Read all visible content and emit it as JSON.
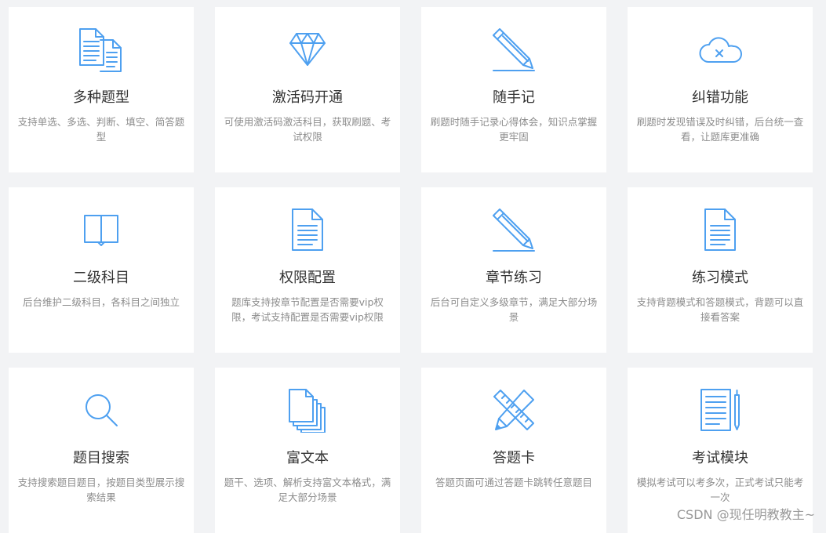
{
  "colors": {
    "accent": "#4ea0f0",
    "title": "#333333",
    "desc": "#8c8c8c",
    "background": "#f2f3f5"
  },
  "features": [
    {
      "icon": "documents-icon",
      "title": "多种题型",
      "desc": "支持单选、多选、判断、填空、简答题型"
    },
    {
      "icon": "diamond-icon",
      "title": "激活码开通",
      "desc": "可使用激活码激活科目，获取刷题、考试权限"
    },
    {
      "icon": "pencil-icon",
      "title": "随手记",
      "desc": "刷题时随手记录心得体会，知识点掌握更牢固"
    },
    {
      "icon": "cloud-error-icon",
      "title": "纠错功能",
      "desc": "刷题时发现错误及时纠错，后台统一查看，让题库更准确"
    },
    {
      "icon": "open-book-icon",
      "title": "二级科目",
      "desc": "后台维护二级科目，各科目之间独立"
    },
    {
      "icon": "document-icon",
      "title": "权限配置",
      "desc": "题库支持按章节配置是否需要vip权限，考试支持配置是否需要vip权限"
    },
    {
      "icon": "pencil-icon",
      "title": "章节练习",
      "desc": "后台可自定义多级章节，满足大部分场景"
    },
    {
      "icon": "document-icon",
      "title": "练习模式",
      "desc": "支持背题模式和答题模式，背题可以直接看答案"
    },
    {
      "icon": "search-icon",
      "title": "题目搜索",
      "desc": "支持搜索题目题目，按题目类型展示搜索结果"
    },
    {
      "icon": "stacked-pages-icon",
      "title": "富文本",
      "desc": "题干、选项、解析支持富文本格式，满足大部分场景"
    },
    {
      "icon": "ruler-pencil-icon",
      "title": "答题卡",
      "desc": "答题页面可通过答题卡跳转任意题目"
    },
    {
      "icon": "notepad-pen-icon",
      "title": "考试模块",
      "desc": "模拟考试可以考多次，正式考试只能考一次"
    }
  ],
  "watermark": "CSDN @现任明教教主~"
}
